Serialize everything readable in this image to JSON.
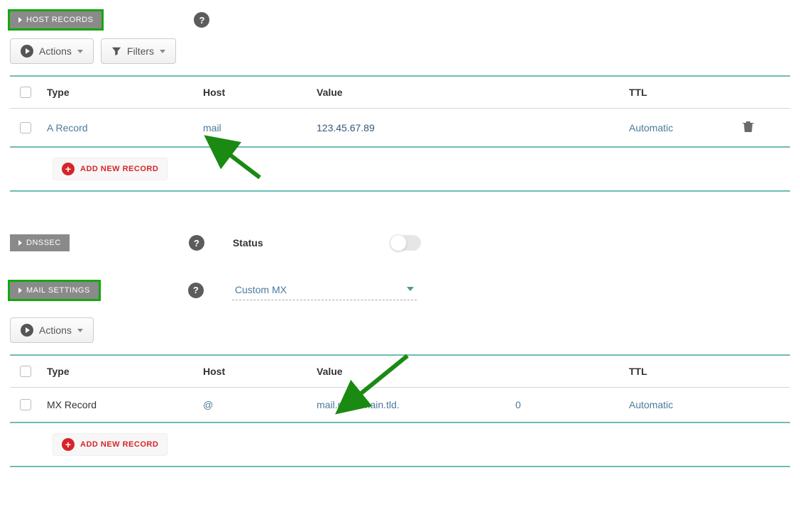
{
  "sections": {
    "host_records_label": "HOST RECORDS",
    "dnssec_label": "DNSSEC",
    "mail_settings_label": "MAIL SETTINGS"
  },
  "buttons": {
    "actions": "Actions",
    "filters": "Filters",
    "add_new_record": "ADD NEW RECORD"
  },
  "host_table": {
    "headers": {
      "type": "Type",
      "host": "Host",
      "value": "Value",
      "ttl": "TTL"
    },
    "row": {
      "type": "A Record",
      "host": "mail",
      "value": "123.45.67.89",
      "ttl": "Automatic"
    }
  },
  "dnssec": {
    "status_label": "Status"
  },
  "mail": {
    "select_value": "Custom MX"
  },
  "mail_table": {
    "headers": {
      "type": "Type",
      "host": "Host",
      "value": "Value",
      "ttl": "TTL"
    },
    "row": {
      "type": "MX Record",
      "host": "@",
      "value": "mail.mydomain.tld.",
      "priority": "0",
      "ttl": "Automatic"
    }
  }
}
